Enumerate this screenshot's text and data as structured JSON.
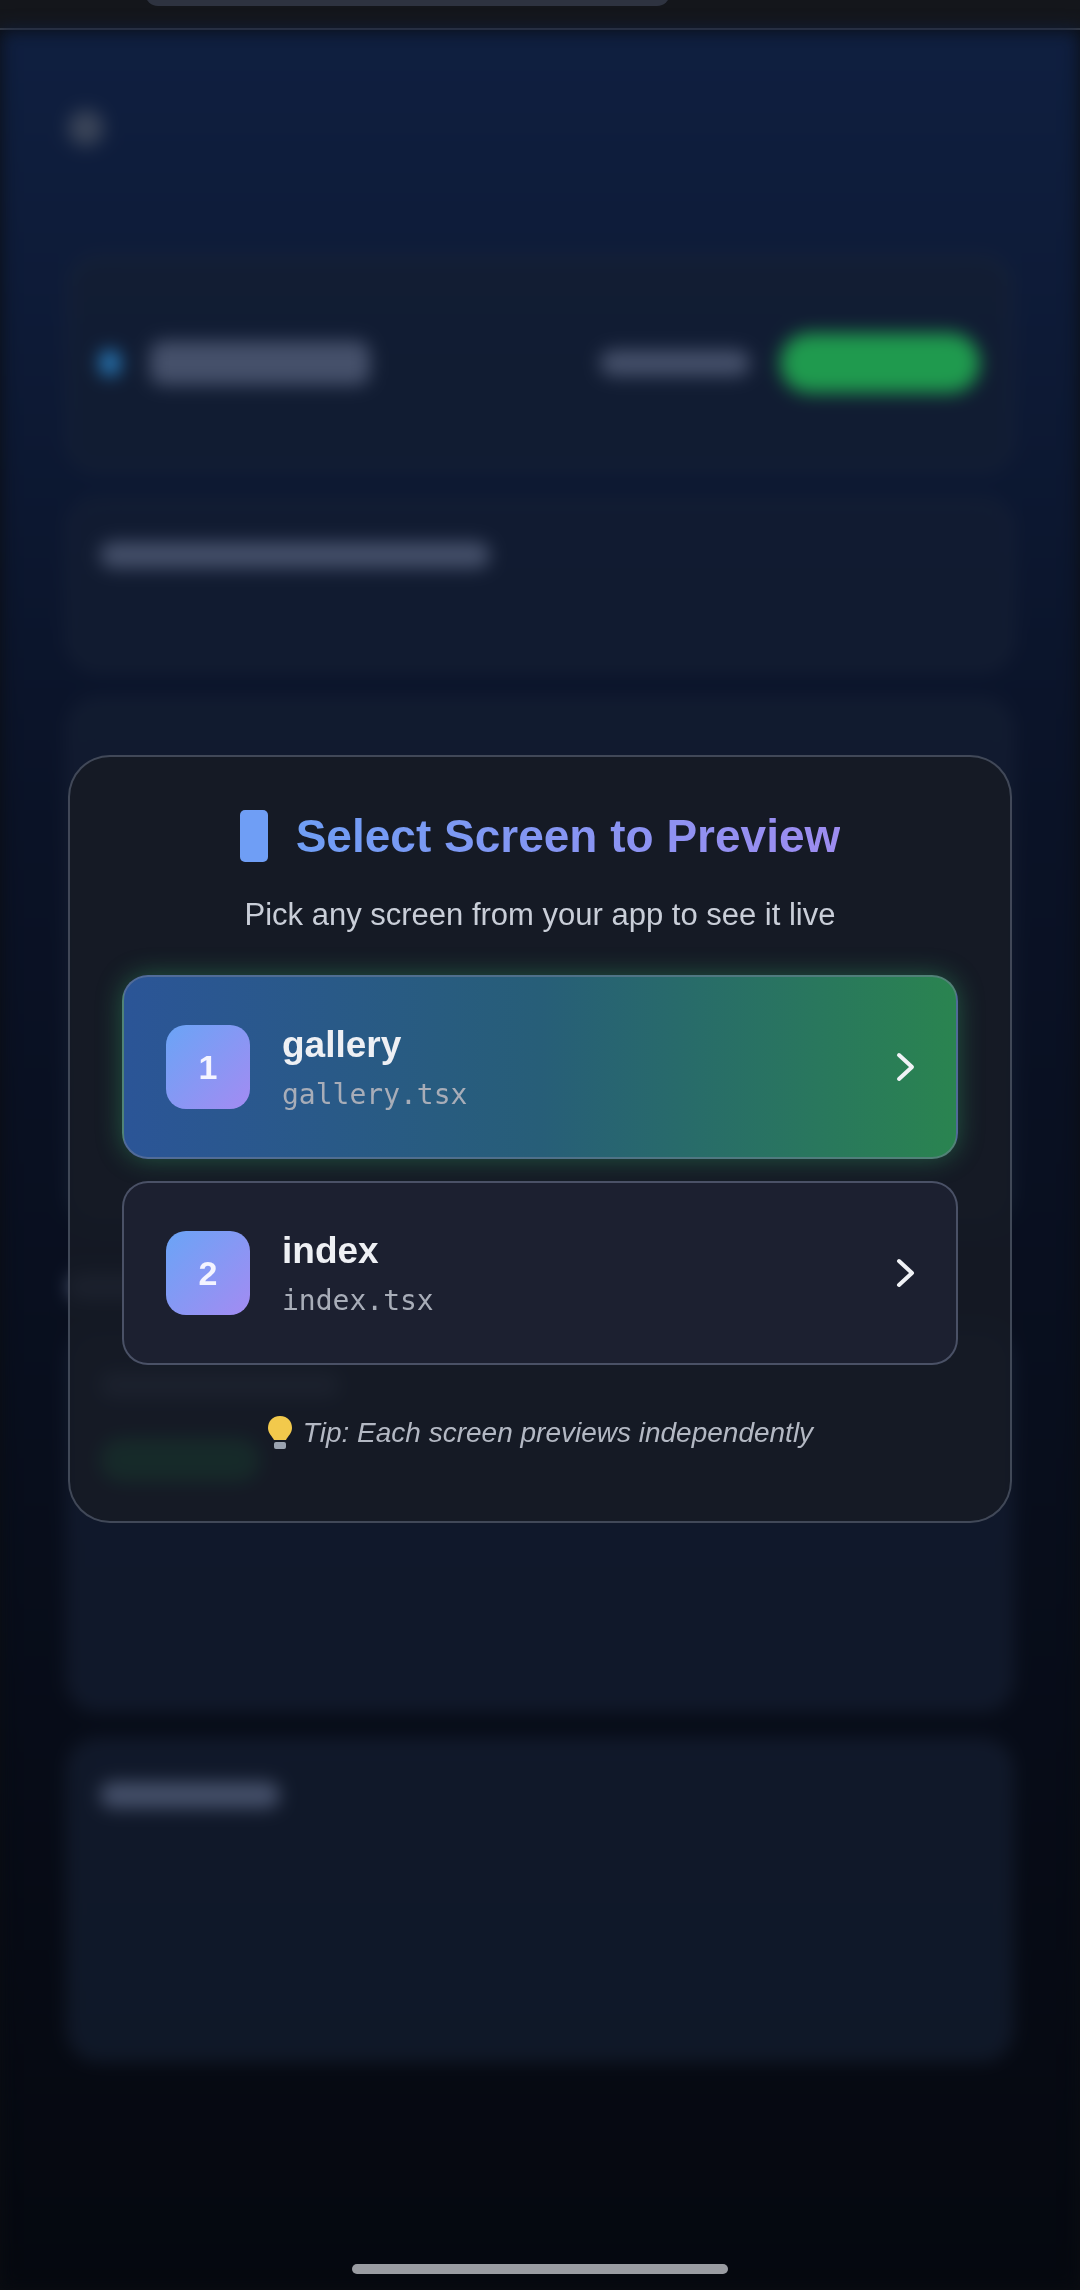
{
  "dialog": {
    "title": "Select Screen to Preview",
    "subtitle": "Pick any screen from your app to see it live",
    "screens": [
      {
        "number": "1",
        "name": "gallery",
        "file": "gallery.tsx",
        "selected": true
      },
      {
        "number": "2",
        "name": "index",
        "file": "index.tsx",
        "selected": false
      }
    ],
    "tip": "Tip: Each screen previews independently"
  }
}
